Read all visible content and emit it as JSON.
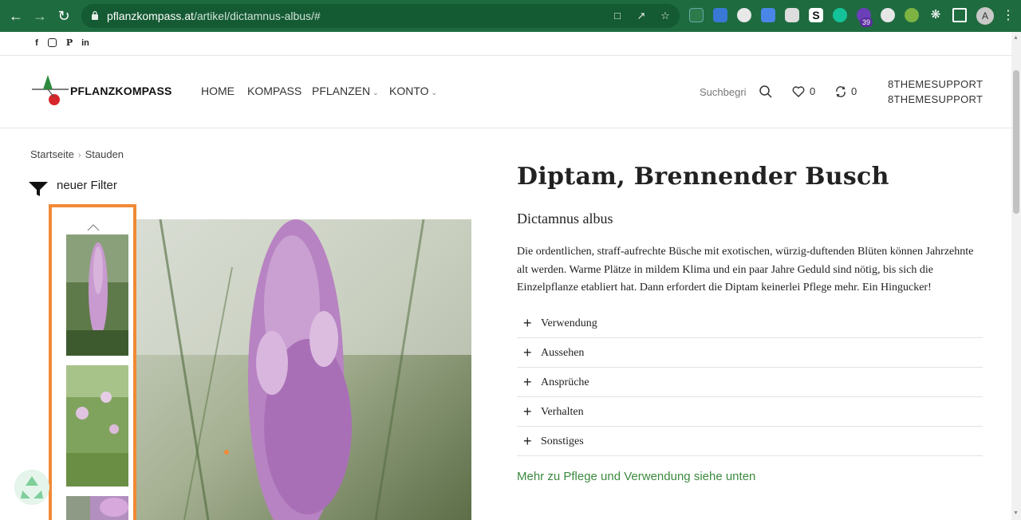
{
  "browser": {
    "url_host": "pflanzkompass.at",
    "url_path": "/artikel/dictamnus-albus/#",
    "avatar_letter": "A",
    "ext_badge": "39"
  },
  "social": [
    "f",
    "IG",
    "P",
    "in"
  ],
  "header": {
    "logo_text": "PFLANZKOMPASS",
    "menu": [
      {
        "label": "HOME",
        "has_dropdown": false
      },
      {
        "label": "KOMPASS",
        "has_dropdown": false
      },
      {
        "label": "PFLANZEN",
        "has_dropdown": true
      },
      {
        "label": "KONTO",
        "has_dropdown": true
      }
    ],
    "search_placeholder": "Suchbegri",
    "wishlist_count": "0",
    "compare_count": "0",
    "account_line1": "8THEMESUPPORT",
    "account_line2": "8THEMESUPPORT"
  },
  "breadcrumb": [
    "Startseite",
    "Stauden"
  ],
  "filter_label": "neuer Filter",
  "product": {
    "title": "Diptam, Brennender Busch",
    "subtitle": "Dictamnus albus",
    "description": "Die ordentlichen, straff-aufrechte Büsche mit exotischen, würzig-duftenden Blüten können Jahrzehnte alt werden. Warme Plätze in mildem Klima und ein paar Jahre Geduld sind nötig, bis sich die Einzelpflanze etabliert hat. Dann erfordert die Diptam keinerlei Pflege mehr. Ein Hingucker!",
    "accordion": [
      "Verwendung",
      "Aussehen",
      "Ansprüche",
      "Verhalten",
      "Sonstiges"
    ],
    "more_link": "Mehr zu Pflege und Verwendung siehe unten"
  },
  "colors": {
    "chrome": "#1e6b3f",
    "accent_orange": "#f08a35",
    "link_green": "#3c8a3f"
  }
}
